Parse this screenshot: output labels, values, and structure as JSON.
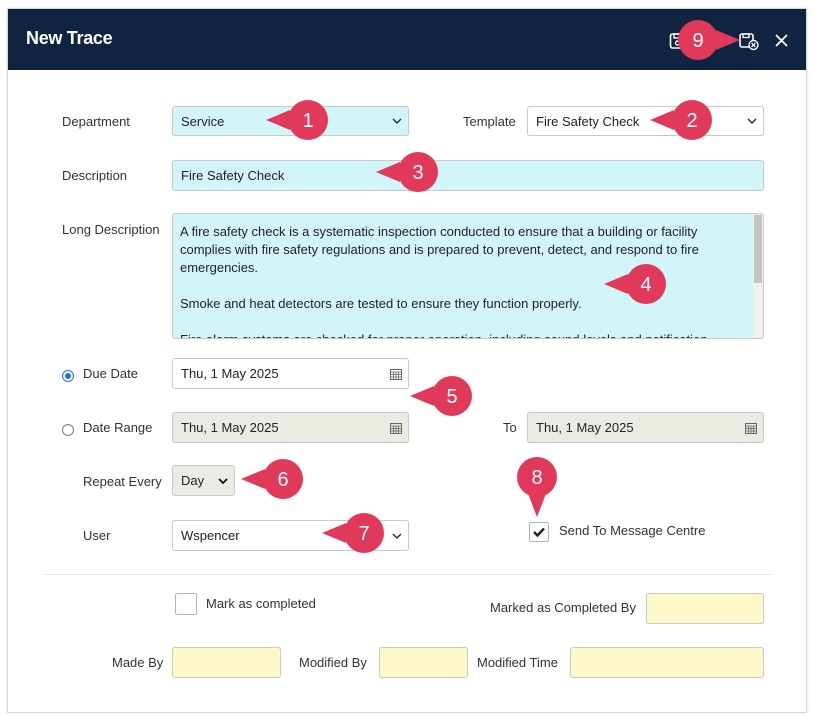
{
  "window": {
    "title": "New Trace",
    "buttons": {
      "save_icon": "save-icon",
      "save_close_icon": "save-close-icon",
      "close_icon": "close-icon"
    }
  },
  "form": {
    "department": {
      "label": "Department",
      "value": "Service"
    },
    "template": {
      "label": "Template",
      "value": "Fire Safety Check"
    },
    "description": {
      "label": "Description",
      "value": "Fire Safety Check"
    },
    "long_description": {
      "label": "Long Description",
      "paragraphs": [
        "A fire safety check is a systematic inspection conducted to ensure that a building or facility complies with fire safety regulations and is prepared to prevent, detect, and respond to fire emergencies.",
        "Smoke and heat detectors are tested to ensure they function properly.",
        "Fire alarm systems are checked for proper operation, including sound levels and notification"
      ]
    },
    "due_date": {
      "label": "Due Date",
      "value": "Thu, 1 May 2025",
      "selected": true
    },
    "date_range": {
      "label": "Date Range",
      "from": "Thu, 1 May 2025",
      "to_label": "To",
      "to": "Thu, 1 May 2025",
      "selected": false
    },
    "repeat_every": {
      "label": "Repeat Every",
      "value": "Day"
    },
    "user": {
      "label": "User",
      "value": "Wspencer"
    },
    "send_to_message_centre": {
      "label": "Send To Message Centre",
      "checked": true
    },
    "mark_as_completed": {
      "label": "Mark as completed",
      "checked": false
    },
    "marked_completed_by": {
      "label": "Marked as Completed By",
      "value": ""
    },
    "made_by": {
      "label": "Made By",
      "value": ""
    },
    "modified_by": {
      "label": "Modified By",
      "value": ""
    },
    "modified_time": {
      "label": "Modified Time",
      "value": ""
    }
  },
  "callouts": [
    "1",
    "2",
    "3",
    "4",
    "5",
    "6",
    "7",
    "8",
    "9"
  ],
  "colors": {
    "titlebar": "#0e2440",
    "callout": "#e0395a",
    "field_cyan": "#d2f5fa",
    "field_yellow": "#fff8c8",
    "field_grey": "#ebebe4",
    "radio_accent": "#1a73e8"
  }
}
